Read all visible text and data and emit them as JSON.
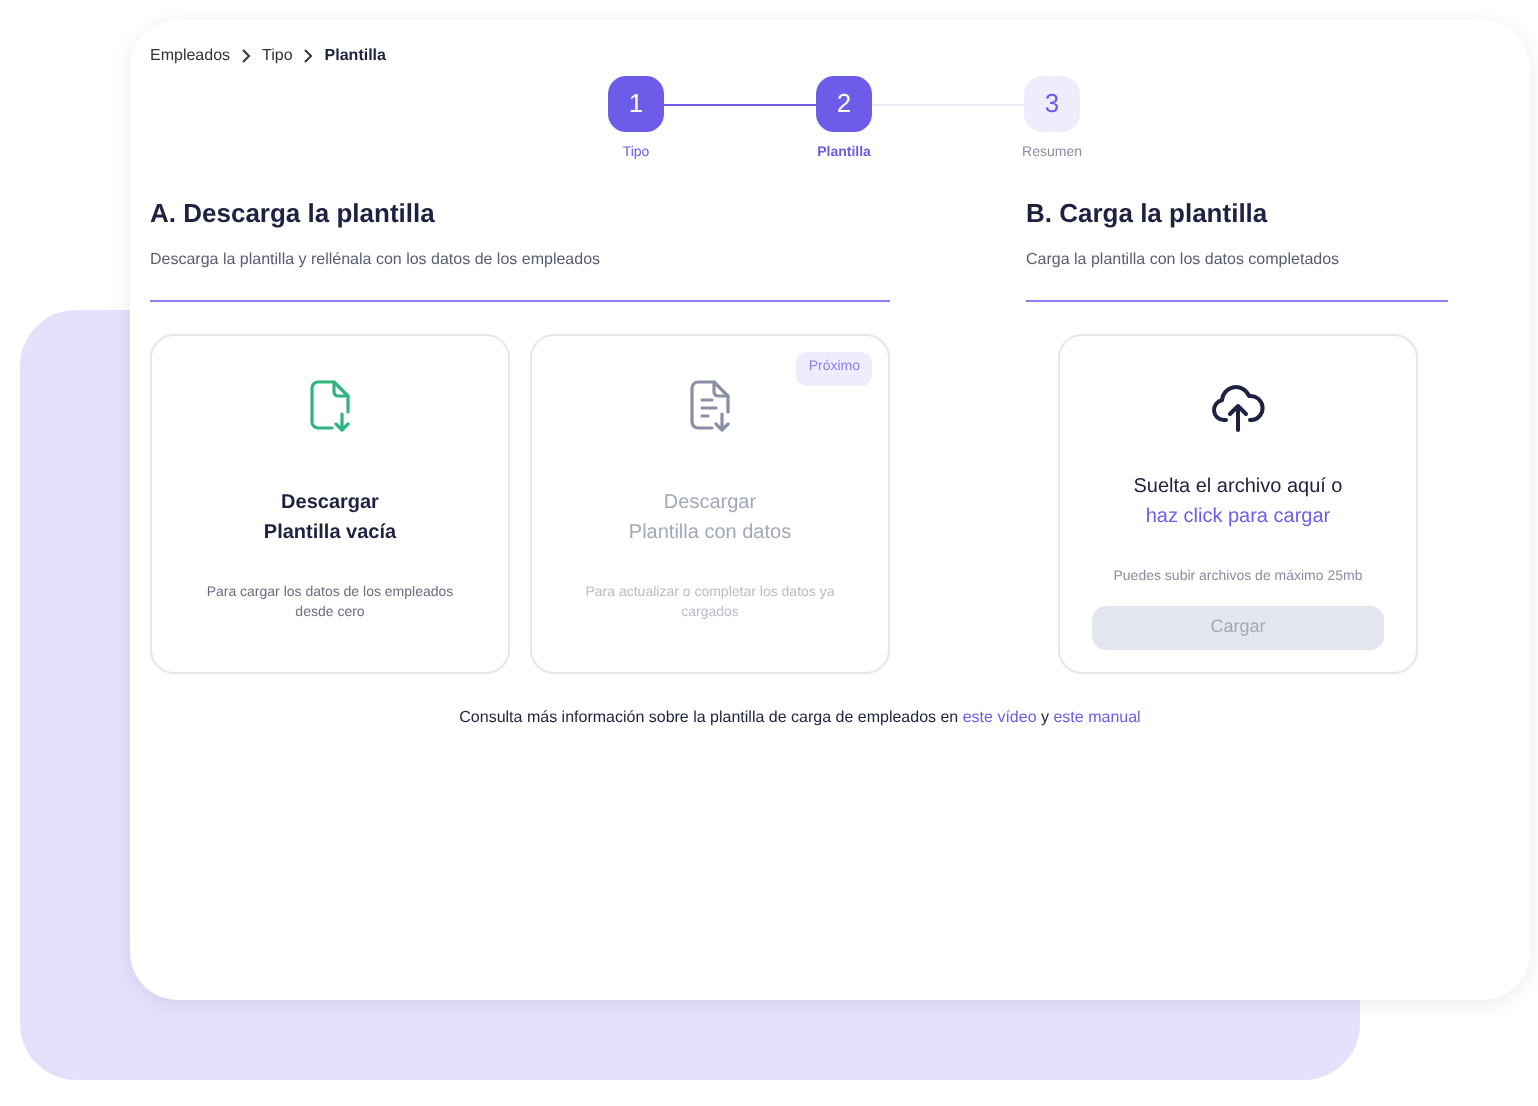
{
  "breadcrumb": [
    {
      "label": "Empleados",
      "current": false
    },
    {
      "label": "Tipo",
      "current": false
    },
    {
      "label": "Plantilla",
      "current": true
    }
  ],
  "steps": [
    {
      "number": "1",
      "label": "Tipo",
      "completed": true,
      "selected": false
    },
    {
      "number": "2",
      "label": "Plantilla",
      "completed": false,
      "selected": true
    },
    {
      "number": "3",
      "label": "Resumen",
      "completed": false,
      "selected": false
    }
  ],
  "download": {
    "title": "A. Descarga la plantilla",
    "subtitle": "Descarga la plantilla y rellénala con los datos de los empleados",
    "options": [
      {
        "kind": "empty",
        "title_lines": [
          "Descargar",
          "Plantilla vacía"
        ],
        "description": "Para cargar los datos de los empleados desde cero",
        "disabled": false
      },
      {
        "kind": "filled",
        "title_lines": [
          "Descargar",
          "Plantilla con datos"
        ],
        "description": "Para actualizar o completar los datos ya cargados",
        "disabled": true,
        "badge": "Próximo"
      }
    ]
  },
  "upload": {
    "title": "B. Carga la plantilla",
    "subtitle": "Carga la plantilla con los datos completados",
    "drop_text": "Suelta el archivo aquí o",
    "drop_link": "haz click para cargar",
    "hint": "Puedes subir archivos de máximo 25mb",
    "button": {
      "label": "Cargar",
      "disabled": true
    }
  },
  "info": [
    {
      "kind": "text",
      "text": "Consulta más información sobre la plantilla de carga de empleados en "
    },
    {
      "kind": "link",
      "text": "este vídeo"
    },
    {
      "kind": "text",
      "text": " y "
    },
    {
      "kind": "link",
      "text": "este manual"
    }
  ]
}
